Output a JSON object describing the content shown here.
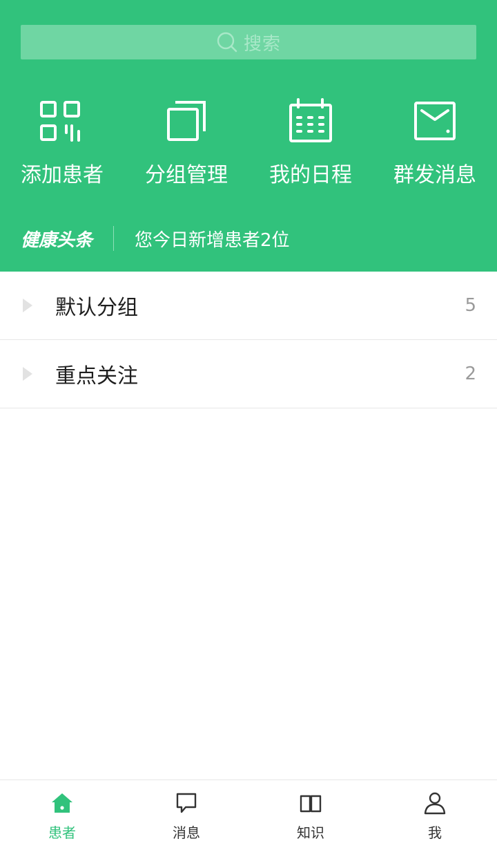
{
  "colors": {
    "brand": "#31c27c",
    "search_bg": "#6fd6a3",
    "text_dark": "#1e1e1e",
    "count": "#9a9a9a"
  },
  "search": {
    "placeholder": "搜索",
    "icon": "search-icon"
  },
  "actions": [
    {
      "label": "添加患者",
      "icon": "qrcode-scan-icon"
    },
    {
      "label": "分组管理",
      "icon": "copy-group-icon"
    },
    {
      "label": "我的日程",
      "icon": "calendar-icon"
    },
    {
      "label": "群发消息",
      "icon": "mail-icon"
    }
  ],
  "news": {
    "title": "健康头条",
    "text": "您今日新增患者2位"
  },
  "groups": [
    {
      "name": "默认分组",
      "count": "5"
    },
    {
      "name": "重点关注",
      "count": "2"
    }
  ],
  "tabs": [
    {
      "label": "患者",
      "icon": "home-icon",
      "active": true
    },
    {
      "label": "消息",
      "icon": "chat-icon",
      "active": false
    },
    {
      "label": "知识",
      "icon": "book-icon",
      "active": false
    },
    {
      "label": "我",
      "icon": "user-icon",
      "active": false
    }
  ]
}
